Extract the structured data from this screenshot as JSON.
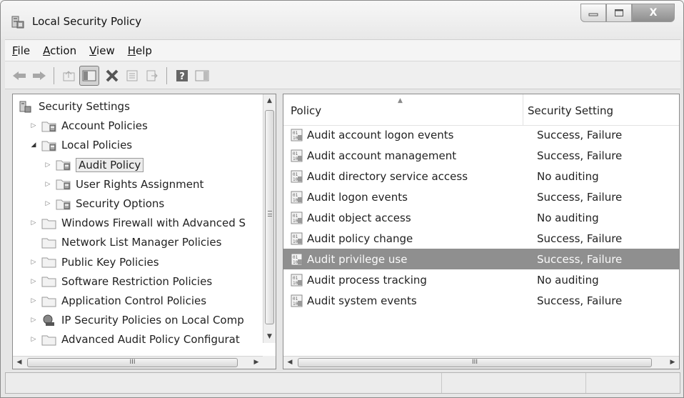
{
  "window": {
    "title": "Local Security Policy",
    "icon": "local-security-policy-icon"
  },
  "title_buttons": {
    "minimize": "▭",
    "maximize": "□",
    "close": "X"
  },
  "menu": [
    {
      "label": "File",
      "accel": "F",
      "rest": "ile"
    },
    {
      "label": "Action",
      "accel": "A",
      "rest": "ction"
    },
    {
      "label": "View",
      "accel": "V",
      "rest": "iew"
    },
    {
      "label": "Help",
      "accel": "H",
      "rest": "elp"
    }
  ],
  "toolbar": [
    "back-arrow-icon",
    "forward-arrow-icon",
    "up-folder-icon",
    "show-hide-console-tree-icon",
    "delete-icon",
    "properties-icon",
    "export-list-icon",
    "help-icon",
    "show-hide-action-pane-icon"
  ],
  "tree": [
    {
      "label": "Security Settings",
      "level": 0,
      "arrow": "",
      "icon": "security-settings-icon"
    },
    {
      "label": "Account Policies",
      "level": 1,
      "arrow": "closed",
      "icon": "policy-folder-icon"
    },
    {
      "label": "Local Policies",
      "level": 1,
      "arrow": "open",
      "icon": "policy-folder-icon"
    },
    {
      "label": "Audit Policy",
      "level": 2,
      "arrow": "closed",
      "icon": "policy-folder-icon",
      "selected": true
    },
    {
      "label": "User Rights Assignment",
      "level": 2,
      "arrow": "closed",
      "icon": "policy-folder-icon"
    },
    {
      "label": "Security Options",
      "level": 2,
      "arrow": "closed",
      "icon": "policy-folder-icon"
    },
    {
      "label": "Windows Firewall with Advanced S",
      "level": 1,
      "arrow": "closed",
      "icon": "folder-icon"
    },
    {
      "label": "Network List Manager Policies",
      "level": 1,
      "arrow": "",
      "icon": "folder-icon"
    },
    {
      "label": "Public Key Policies",
      "level": 1,
      "arrow": "closed",
      "icon": "folder-icon"
    },
    {
      "label": "Software Restriction Policies",
      "level": 1,
      "arrow": "closed",
      "icon": "folder-icon"
    },
    {
      "label": "Application Control Policies",
      "level": 1,
      "arrow": "closed",
      "icon": "folder-icon"
    },
    {
      "label": "IP Security Policies on Local Comp",
      "level": 1,
      "arrow": "closed",
      "icon": "ip-security-icon"
    },
    {
      "label": "Advanced Audit Policy Configurat",
      "level": 1,
      "arrow": "closed",
      "icon": "folder-icon"
    }
  ],
  "list": {
    "columns": {
      "policy": "Policy",
      "setting": "Security Setting"
    },
    "rows": [
      {
        "policy": "Audit account logon events",
        "setting": "Success, Failure"
      },
      {
        "policy": "Audit account management",
        "setting": "Success, Failure"
      },
      {
        "policy": "Audit directory service access",
        "setting": "No auditing"
      },
      {
        "policy": "Audit logon events",
        "setting": "Success, Failure"
      },
      {
        "policy": "Audit object access",
        "setting": "No auditing"
      },
      {
        "policy": "Audit policy change",
        "setting": "Success, Failure"
      },
      {
        "policy": "Audit privilege use",
        "setting": "Success, Failure",
        "selected": true
      },
      {
        "policy": "Audit process tracking",
        "setting": "No auditing"
      },
      {
        "policy": "Audit system events",
        "setting": "Success, Failure"
      }
    ]
  },
  "scrollbars": {
    "h_thumb_grip": "III"
  }
}
